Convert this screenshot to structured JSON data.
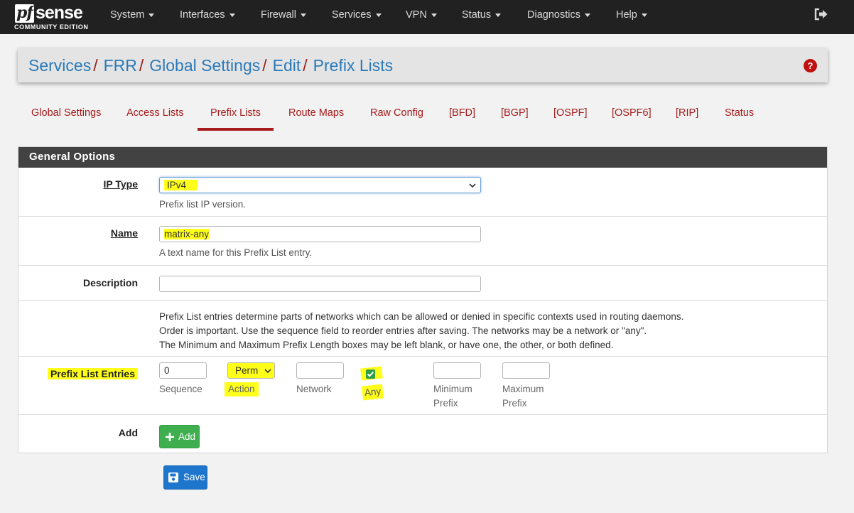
{
  "brand": {
    "logo_text_a": "pf",
    "logo_text_b": "sense",
    "edition": "COMMUNITY EDITION"
  },
  "nav": {
    "items": [
      {
        "label": "System"
      },
      {
        "label": "Interfaces"
      },
      {
        "label": "Firewall"
      },
      {
        "label": "Services"
      },
      {
        "label": "VPN"
      },
      {
        "label": "Status"
      },
      {
        "label": "Diagnostics"
      },
      {
        "label": "Help"
      }
    ],
    "logout_icon": "logout-icon"
  },
  "breadcrumb": {
    "items": [
      "Services",
      "FRR",
      "Global Settings",
      "Edit",
      "Prefix Lists"
    ],
    "separator": "/",
    "help_icon": "question-circle-icon"
  },
  "tabs": [
    {
      "label": "Global Settings"
    },
    {
      "label": "Access Lists"
    },
    {
      "label": "Prefix Lists",
      "active": true
    },
    {
      "label": "Route Maps"
    },
    {
      "label": "Raw Config"
    },
    {
      "label": "[BFD]"
    },
    {
      "label": "[BGP]"
    },
    {
      "label": "[OSPF]"
    },
    {
      "label": "[OSPF6]"
    },
    {
      "label": "[RIP]"
    },
    {
      "label": "Status"
    }
  ],
  "panel": {
    "title": "General Options",
    "ip_type": {
      "label": "IP Type",
      "value": "IPv4",
      "help": "Prefix list IP version."
    },
    "name": {
      "label": "Name",
      "value": "matrix-any",
      "help": "A text name for this Prefix List entry."
    },
    "description": {
      "label": "Description",
      "value": ""
    },
    "info": [
      "Prefix List entries determine parts of networks which can be allowed or denied in specific contexts used in routing daemons.",
      "Order is important. Use the sequence field to reorder entries after saving. The networks may be a network or \"any\".",
      "The Minimum and Maximum Prefix Length boxes may be left blank, or have one, the other, or both defined."
    ],
    "entries": {
      "label": "Prefix List Entries",
      "sequence": {
        "value": "0",
        "label": "Sequence"
      },
      "action": {
        "value": "Perm",
        "label": "Action"
      },
      "network": {
        "value": "",
        "label": "Network"
      },
      "any": {
        "checked": true,
        "label": "Any"
      },
      "min_prefix": {
        "value": "",
        "label_a": "Minimum",
        "label_b": "Prefix"
      },
      "max_prefix": {
        "value": "",
        "label_a": "Maximum",
        "label_b": "Prefix"
      }
    },
    "add": {
      "label": "Add",
      "button": "Add"
    }
  },
  "save_button": "Save",
  "colors": {
    "navbar": "#212121",
    "link_blue": "#2a79b8",
    "tab_red": "#a61b1b",
    "panel_header": "#424242",
    "add_green": "#3eae4f",
    "save_blue": "#1e76cc",
    "highlight_yellow": "#ffff1a"
  }
}
